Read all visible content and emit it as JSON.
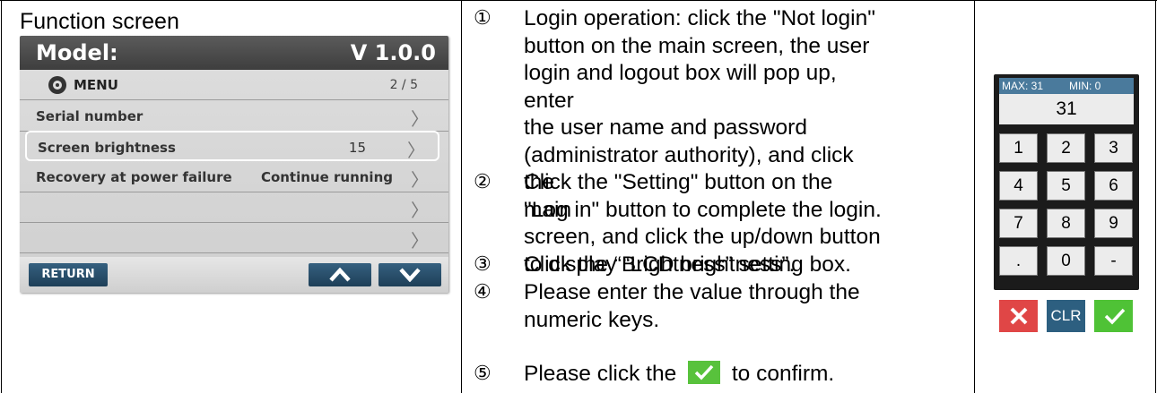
{
  "left": {
    "title": "Function screen",
    "device": {
      "model_label": "Model:",
      "version": "V 1.0.0",
      "menu_label": "MENU",
      "page": "2 / 5",
      "rows": [
        {
          "label": "Serial number",
          "value": ""
        },
        {
          "label": "Screen brightness",
          "value": "15"
        },
        {
          "label": "Recovery at power failure",
          "value": "Continue running"
        },
        {
          "label": "",
          "value": ""
        },
        {
          "label": "",
          "value": ""
        }
      ],
      "return_label": "RETURN",
      "chevron": "〉"
    }
  },
  "steps": [
    {
      "num": "①",
      "lines": [
        "Login operation: click the \"Not login\"",
        "button on the main screen, the user",
        "login and logout box will pop up, enter",
        "the user name and password",
        "(administrator authority), and click the",
        "\"Log in\" button to complete the login."
      ]
    },
    {
      "num": "②",
      "lines": [
        "Click the \"Setting\" button on the main",
        "screen, and click the up/down button",
        "to display “LCD brightness”."
      ]
    },
    {
      "num": "③",
      "lines": [
        "Click the “Brightness” setting box."
      ]
    },
    {
      "num": "④",
      "lines": [
        "Please enter the value through the",
        "numeric keys."
      ]
    },
    {
      "num": "⑤",
      "before": "Please click the",
      "after": "to confirm."
    }
  ],
  "keypad": {
    "max_label": "MAX: 31",
    "min_label": "MIN: 0",
    "display": "31",
    "keys": [
      "1",
      "2",
      "3",
      "4",
      "5",
      "6",
      "7",
      "8",
      "9",
      ".",
      "0",
      "-"
    ],
    "clr_label": "CLR"
  },
  "colors": {
    "accent_blue": "#2d5f80",
    "confirm_green": "#4fc236",
    "cancel_red": "#e04646"
  }
}
